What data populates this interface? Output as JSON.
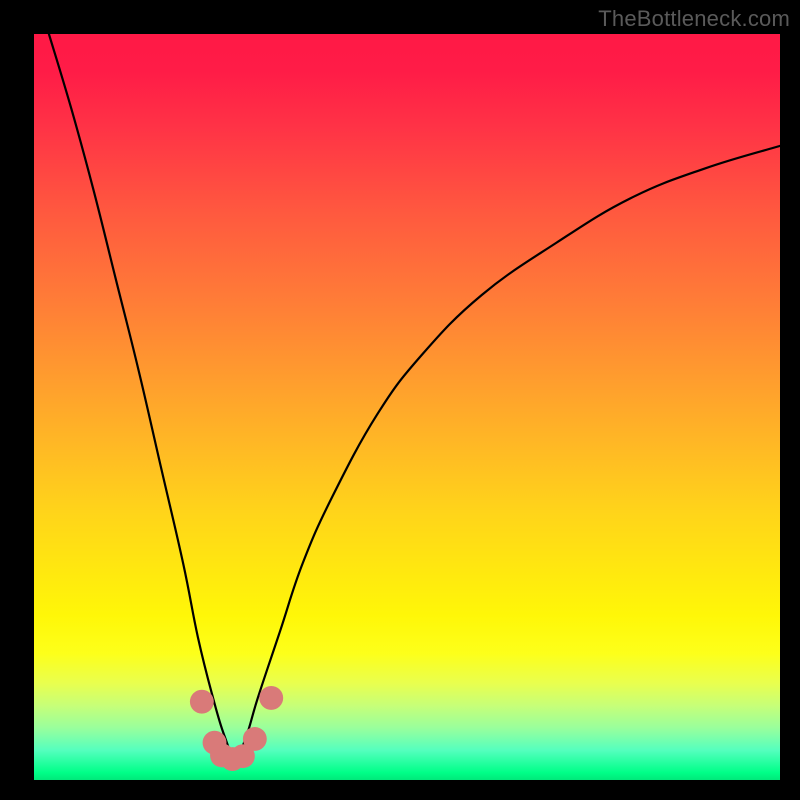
{
  "attribution": "TheBottleneck.com",
  "chart_data": {
    "type": "line",
    "title": "",
    "xlabel": "",
    "ylabel": "",
    "xlim": [
      0,
      100
    ],
    "ylim": [
      0,
      100
    ],
    "grid": false,
    "legend": false,
    "notch_x": 27,
    "series": [
      {
        "name": "curve",
        "color": "#000000",
        "x": [
          2,
          5,
          8,
          11,
          14,
          17,
          20,
          22,
          24,
          25.5,
          27,
          28.5,
          30,
          33,
          36,
          40,
          46,
          52,
          60,
          70,
          80,
          90,
          100
        ],
        "y": [
          100,
          90,
          79,
          67,
          55,
          42,
          29,
          19,
          11,
          6,
          3,
          6,
          11,
          20,
          29,
          38,
          49,
          57,
          65,
          72,
          78,
          82,
          85
        ]
      }
    ],
    "markers": [
      {
        "name": "left-outer",
        "x": 22.5,
        "y": 10.5,
        "r": 1.6,
        "color": "#d97a79"
      },
      {
        "name": "left-inner",
        "x": 24.2,
        "y": 5.0,
        "r": 1.6,
        "color": "#d97a79"
      },
      {
        "name": "bottom-a",
        "x": 25.2,
        "y": 3.3,
        "r": 1.6,
        "color": "#d97a79"
      },
      {
        "name": "bottom-b",
        "x": 26.6,
        "y": 2.8,
        "r": 1.6,
        "color": "#d97a79"
      },
      {
        "name": "bottom-c",
        "x": 28.0,
        "y": 3.2,
        "r": 1.6,
        "color": "#d97a79"
      },
      {
        "name": "right-inner",
        "x": 29.6,
        "y": 5.5,
        "r": 1.6,
        "color": "#d97a79"
      },
      {
        "name": "right-outer",
        "x": 31.8,
        "y": 11.0,
        "r": 1.6,
        "color": "#d97a79"
      }
    ]
  }
}
